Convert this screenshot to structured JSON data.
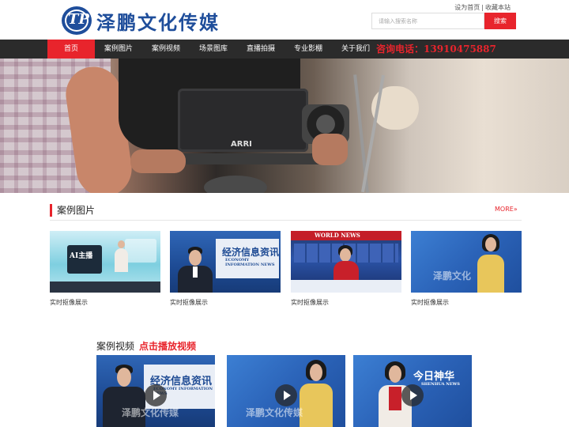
{
  "top_links": {
    "set_home": "设为首页",
    "separator": "|",
    "bookmark": "收藏本站"
  },
  "logo": {
    "mark": "TP",
    "name": "泽鹏文化传媒"
  },
  "search": {
    "placeholder": "请输入搜索名称",
    "button": "搜索"
  },
  "nav": {
    "items": [
      {
        "label": "首页",
        "active": true
      },
      {
        "label": "案例图片",
        "active": false
      },
      {
        "label": "案例视频",
        "active": false
      },
      {
        "label": "场景图库",
        "active": false
      },
      {
        "label": "直播拍摄",
        "active": false
      },
      {
        "label": "专业影棚",
        "active": false
      },
      {
        "label": "关于我们",
        "active": false
      }
    ],
    "phone": "咨询电话：13910475887"
  },
  "banner": {
    "camera_brand": "ARRI"
  },
  "photos": {
    "title": "案例图片",
    "more": "MORE»",
    "cards": [
      {
        "caption": "实时抠像展示",
        "overlay": "AI主播",
        "icon": "studio-icon"
      },
      {
        "caption": "实时抠像展示",
        "overlay": "经济信息资讯",
        "sub": "ECONOMY INFORMATION NEWS"
      },
      {
        "caption": "实时抠像展示",
        "overlay": "WORLD NEWS"
      },
      {
        "caption": "实时抠像展示",
        "overlay": "泽鹏文化"
      }
    ]
  },
  "videos": {
    "title": "案例视频",
    "subtitle": "点击播放视频",
    "cards": [
      {
        "overlay": "经济信息资讯",
        "sub": "ECONOMY INFORMATION NEWS",
        "watermark": "泽鹏文化传媒"
      },
      {
        "watermark": "泽鹏文化传媒"
      },
      {
        "overlay": "今日神华",
        "sub": "SHENHUA NEWS"
      }
    ]
  },
  "colors": {
    "accent": "#e8242c",
    "nav_bg": "#2b2b2b",
    "logo_blue": "#1f4e9b"
  }
}
